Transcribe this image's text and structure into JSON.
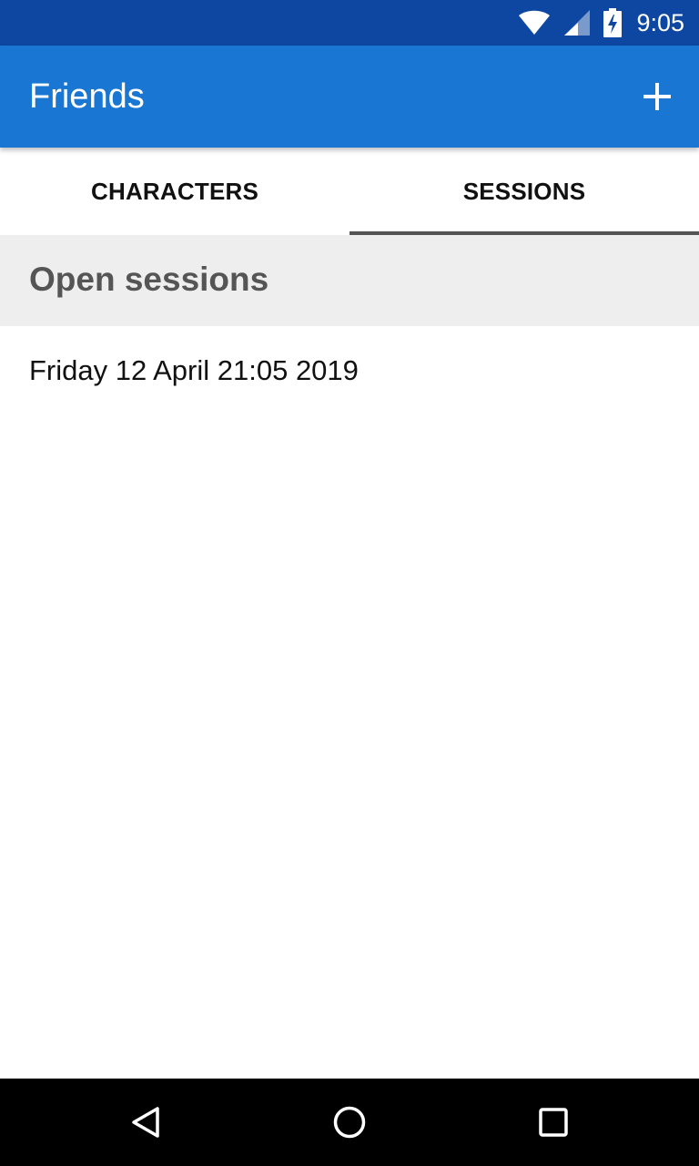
{
  "status_bar": {
    "time": "9:05",
    "icons": [
      "wifi-icon",
      "cell-signal-icon",
      "battery-charging-icon"
    ],
    "color": "#0d47a1"
  },
  "app_bar": {
    "title": "Friends",
    "action_icon": "add-icon",
    "color": "#1976d2"
  },
  "tabs": [
    {
      "label": "CHARACTERS",
      "selected": false
    },
    {
      "label": "SESSIONS",
      "selected": true
    }
  ],
  "section": {
    "title": "Open sessions"
  },
  "sessions": [
    {
      "label": "Friday 12 April 21:05 2019"
    }
  ],
  "nav_bar": {
    "icons": [
      "back-icon",
      "home-icon",
      "recents-icon"
    ]
  }
}
